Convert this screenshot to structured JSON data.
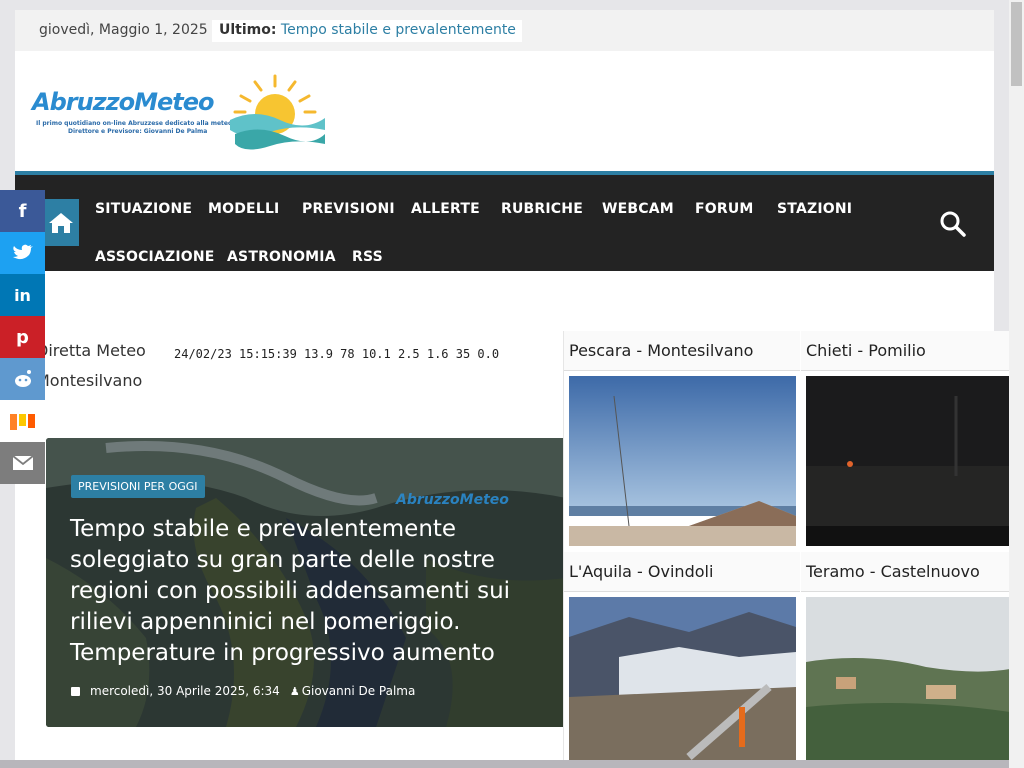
{
  "topbar": {
    "date": "giovedì, Maggio 1, 2025",
    "ticker_label": "Ultimo:",
    "ticker_text": "Tempo stabile e prevalentemente"
  },
  "logo": {
    "name": "AbruzzoMeteo",
    "tagline1": "Il primo quotidiano on-line Abruzzese dedicato alla meteorologia",
    "tagline2": "Direttore e Previsore: Giovanni De Palma"
  },
  "nav": {
    "items": [
      "SITUAZIONE",
      "MODELLI",
      "PREVISIONI",
      "ALLERTE",
      "RUBRICHE",
      "WEBCAM",
      "FORUM",
      "STAZIONI",
      "ASSOCIAZIONE",
      "ASTRONOMIA",
      "RSS"
    ]
  },
  "share": [
    "f",
    "t",
    "in",
    "p",
    "r",
    "m",
    "e"
  ],
  "live": {
    "line1": "Diretta Meteo",
    "line2": "Montesilvano",
    "readings": "24/02/23 15:15:39 13.9 78 10.1 2.5 1.6 35 0.0"
  },
  "article": {
    "category": "PREVISIONI PER OGGI",
    "title": "Tempo stabile e prevalentemente soleggiato su gran parte delle nostre regioni con possibili addensamenti sui rilievi appenninici nel pomeriggio. Temperature in progressivo aumento",
    "date": "mercoledì, 30 Aprile 2025, 6:34",
    "author": "Giovanni De Palma",
    "watermark": "AbruzzoMeteo"
  },
  "webcams": [
    {
      "label": "Pescara - Montesilvano"
    },
    {
      "label": "Chieti - Pomilio"
    },
    {
      "label": "L'Aquila - Ovindoli"
    },
    {
      "label": "Teramo - Castelnuovo"
    }
  ],
  "colors": {
    "accent": "#2d7fa4",
    "nav_bg": "#232323"
  }
}
